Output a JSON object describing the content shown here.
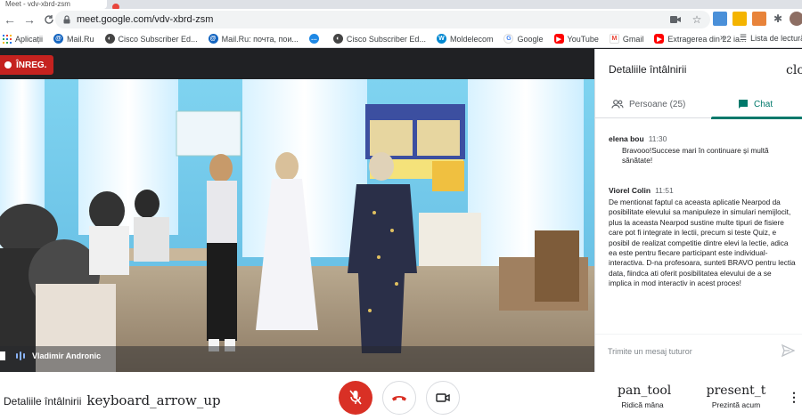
{
  "browser": {
    "tab_title": "Meet - vdv-xbrd-zsm",
    "url": "meet.google.com/vdv-xbrd-zsm"
  },
  "bookmarks": {
    "items": [
      {
        "label": "Aplicații",
        "icon": "apps-grid-icon"
      },
      {
        "label": "Mail.Ru",
        "icon": "mailru-icon"
      },
      {
        "label": "Cisco Subscriber Ed...",
        "icon": "cisco-icon"
      },
      {
        "label": "Mail.Ru: почта, пои...",
        "icon": "mailru-icon"
      },
      {
        "label": "",
        "icon": "chat-bubble-icon"
      },
      {
        "label": "Cisco Subscriber Ed...",
        "icon": "cisco-icon"
      },
      {
        "label": "Moldelecom",
        "icon": "moldelecom-icon"
      },
      {
        "label": "Google",
        "icon": "google-icon"
      },
      {
        "label": "YouTube",
        "icon": "youtube-icon"
      },
      {
        "label": "Gmail",
        "icon": "gmail-icon"
      },
      {
        "label": "Extragerea din 22 ia...",
        "icon": "youtube-icon"
      }
    ],
    "more": "»",
    "reading_list": "Lista de lectură"
  },
  "meet": {
    "recording_label": "ÎNREG.",
    "speaker_name": "Vladimir Andronic"
  },
  "panel": {
    "title": "Detaliile întâlnirii",
    "close_glyph": "close",
    "tabs": {
      "people": "Persoane (25)",
      "chat": "Chat"
    },
    "messages": [
      {
        "name": "elena bou",
        "time": "11:30",
        "text": "Bravooo!Succese mari în continuare și multă sănătate!"
      },
      {
        "name": "Viorel Colin",
        "time": "11:51",
        "text": "De mentionat faptul ca aceasta aplicatie Nearpod da posibilitate elevului sa manipuleze in simulari nemijlocit, plus la aceasta Nearpod sustine multe tipuri de fisiere care pot fi integrate in lectii, precum si teste Quiz, e posibil de realizat competitie dintre elevi la lectie, adica ea este pentru fiecare participant este individual-interactiva. D-na profesoara, sunteti BRAVO pentru lectia data, fiindca ati oferit posibilitatea elevului de a se implica in mod interactiv in acest proces!"
      }
    ],
    "compose_placeholder": "Trimite un mesaj tuturor"
  },
  "bottombar": {
    "details_label": "Detaliile întâlnirii",
    "details_glyph": "keyboard_arrow_up",
    "raise_glyph": "pan_tool",
    "raise_label": "Ridică mâna",
    "present_glyph": "present_t",
    "present_label": "Prezintă acum",
    "more_glyph": "⋮"
  },
  "colors": {
    "accent": "#00796b",
    "record": "#c5221f",
    "mic_off": "#d93025",
    "hangup_icon": "#d93025"
  }
}
